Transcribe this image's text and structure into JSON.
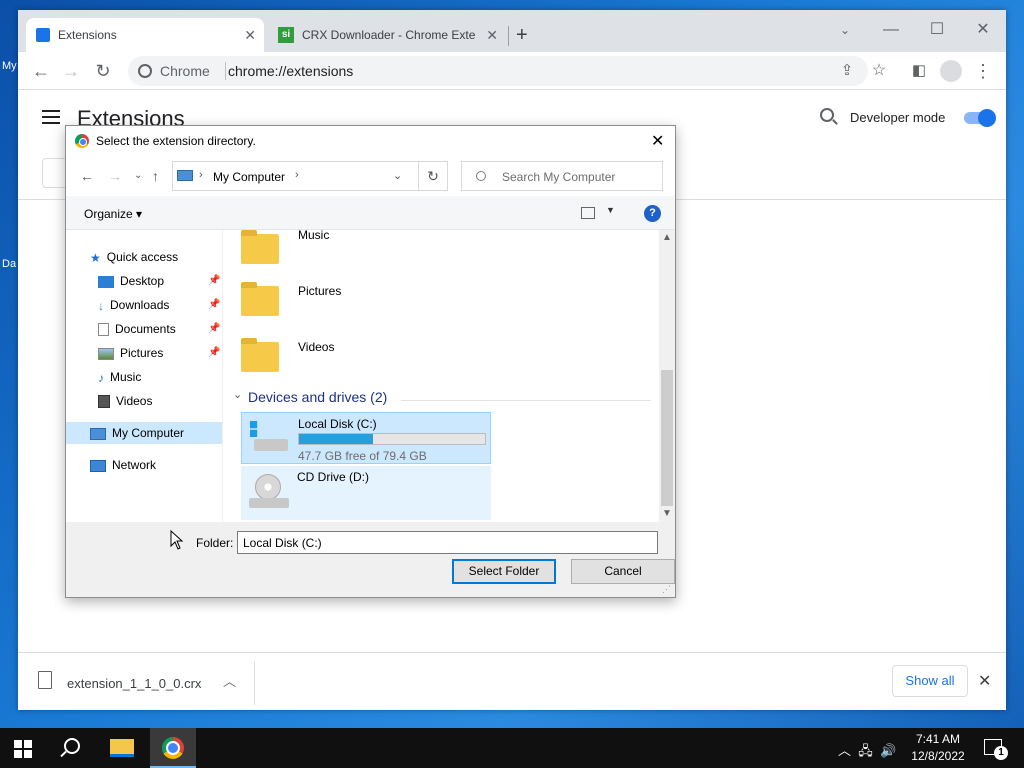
{
  "desktop": {
    "frag1": "My",
    "frag2": "Da"
  },
  "tabs": [
    {
      "title": "Extensions",
      "icon": "puzzle-icon"
    },
    {
      "title": "CRX Downloader - Chrome Exte",
      "icon": "si-favicon",
      "favicon_text": "si"
    }
  ],
  "toolbar": {
    "site_label": "Chrome",
    "url": "chrome://extensions"
  },
  "extensions_page": {
    "title": "Extensions",
    "developer_mode_label": "Developer mode",
    "developer_mode_on": true
  },
  "download_bar": {
    "file_name": "extension_1_1_0_0.crx",
    "show_all_label": "Show all"
  },
  "dialog": {
    "title": "Select the extension directory.",
    "address": "My Computer",
    "search_placeholder": "Search My Computer",
    "organize_label": "Organize",
    "help_glyph": "?",
    "nav": [
      {
        "label": "Quick access"
      },
      {
        "label": "Desktop"
      },
      {
        "label": "Downloads"
      },
      {
        "label": "Documents"
      },
      {
        "label": "Pictures"
      },
      {
        "label": "Music"
      },
      {
        "label": "Videos"
      },
      {
        "label": "My Computer"
      },
      {
        "label": "Network"
      }
    ],
    "folders": [
      {
        "label": "Music"
      },
      {
        "label": "Pictures"
      },
      {
        "label": "Videos"
      }
    ],
    "group_label": "Devices and drives (2)",
    "drives": [
      {
        "name": "Local Disk (C:)",
        "free": "47.7 GB free of 79.4 GB",
        "used_fraction": 0.4
      },
      {
        "name": "CD Drive (D:)"
      }
    ],
    "folder_field_label": "Folder:",
    "folder_field_value": "Local Disk (C:)",
    "select_button": "Select Folder",
    "cancel_button": "Cancel"
  },
  "taskbar": {
    "time": "7:41 AM",
    "date": "12/8/2022",
    "notification_count": "1"
  },
  "colors": {
    "accent": "#1a73e8",
    "selection": "#cce8ff",
    "drive_fill": "#26a0da"
  }
}
